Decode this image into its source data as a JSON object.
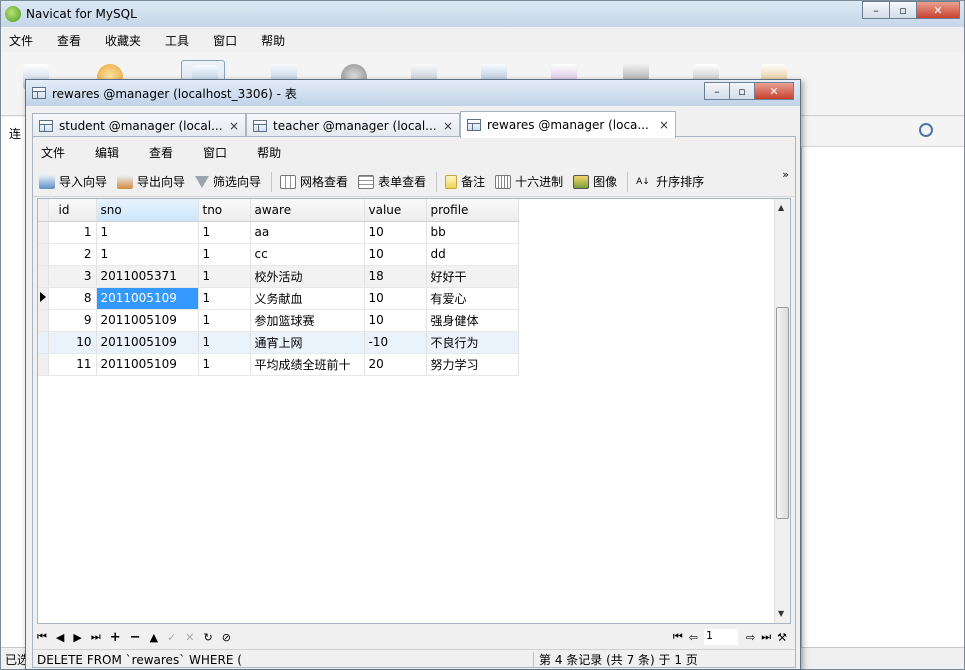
{
  "app": {
    "title": "Navicat for MySQL",
    "menu": [
      "文件",
      "查看",
      "收藏夹",
      "工具",
      "窗口",
      "帮助"
    ],
    "left_label": "连",
    "status_left": "已选"
  },
  "child": {
    "title": "rewares @manager (localhost_3306) - 表",
    "tabs": [
      {
        "label": "student @manager (local...",
        "close": "×"
      },
      {
        "label": "teacher @manager (local...",
        "close": "×"
      },
      {
        "label": "rewares @manager (loca...",
        "close": "×"
      }
    ],
    "menu": [
      "文件",
      "编辑",
      "查看",
      "窗口",
      "帮助"
    ],
    "toolbar": {
      "import": "导入向导",
      "export": "导出向导",
      "filter": "筛选向导",
      "grid_view": "网格查看",
      "form_view": "表单查看",
      "memo": "备注",
      "hex": "十六进制",
      "image": "图像",
      "sort": "升序排序",
      "more": "»"
    }
  },
  "grid": {
    "columns": [
      "id",
      "sno",
      "tno",
      "aware",
      "value",
      "profile"
    ],
    "rows": [
      {
        "id": "1",
        "sno": "1",
        "tno": "1",
        "aware": "aa",
        "value": "10",
        "profile": "bb"
      },
      {
        "id": "2",
        "sno": "1",
        "tno": "1",
        "aware": "cc",
        "value": "10",
        "profile": "dd"
      },
      {
        "id": "3",
        "sno": "2011005371",
        "tno": "1",
        "aware": "校外活动",
        "value": "18",
        "profile": "好好干"
      },
      {
        "id": "8",
        "sno": "2011005109",
        "tno": "1",
        "aware": "义务献血",
        "value": "10",
        "profile": "有爱心"
      },
      {
        "id": "9",
        "sno": "2011005109",
        "tno": "1",
        "aware": "参加篮球赛",
        "value": "10",
        "profile": "强身健体"
      },
      {
        "id": "10",
        "sno": "2011005109",
        "tno": "1",
        "aware": "通宵上网",
        "value": "-10",
        "profile": "不良行为"
      },
      {
        "id": "11",
        "sno": "2011005109",
        "tno": "1",
        "aware": "平均成绩全班前十",
        "value": "20",
        "profile": "努力学习"
      }
    ],
    "current_row_index": 3,
    "selected_column": "sno"
  },
  "nav": {
    "page": "1"
  },
  "status": {
    "sql": "DELETE FROM `rewares` WHERE (",
    "record_info": "第 4 条记录 (共 7 条) 于 1 页"
  }
}
